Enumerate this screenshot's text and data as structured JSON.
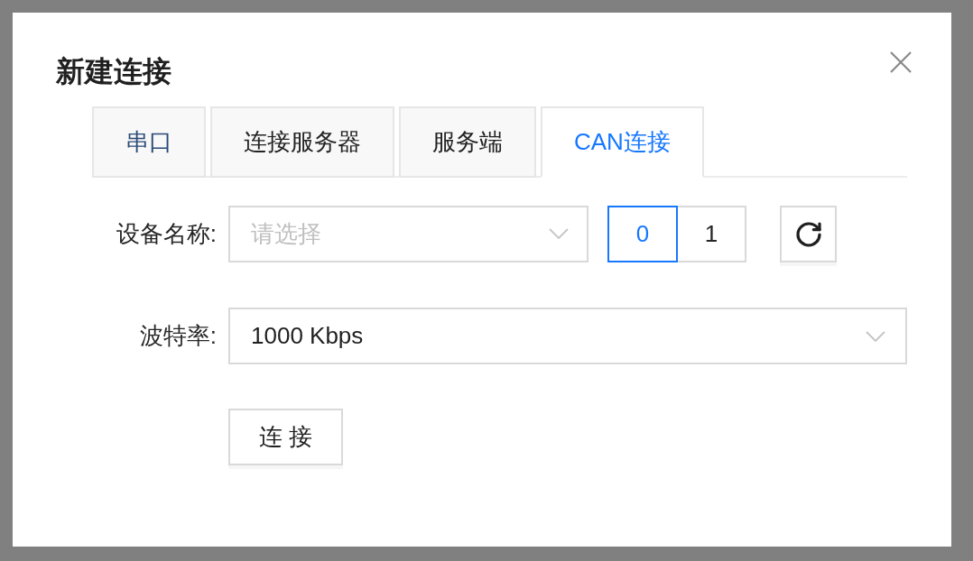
{
  "dialog": {
    "title": "新建连接"
  },
  "tabs": [
    {
      "label": "串口",
      "selected": false,
      "hovered": true
    },
    {
      "label": "连接服务器",
      "selected": false,
      "hovered": false
    },
    {
      "label": "服务端",
      "selected": false,
      "hovered": false
    },
    {
      "label": "CAN连接",
      "selected": true,
      "hovered": false
    }
  ],
  "form": {
    "device": {
      "label": "设备名称:",
      "placeholder": "请选择",
      "channels": [
        {
          "label": "0",
          "selected": true
        },
        {
          "label": "1",
          "selected": false
        }
      ]
    },
    "baud_rate": {
      "label": "波特率:",
      "value": "1000 Kbps"
    }
  },
  "connect_button": "连 接"
}
